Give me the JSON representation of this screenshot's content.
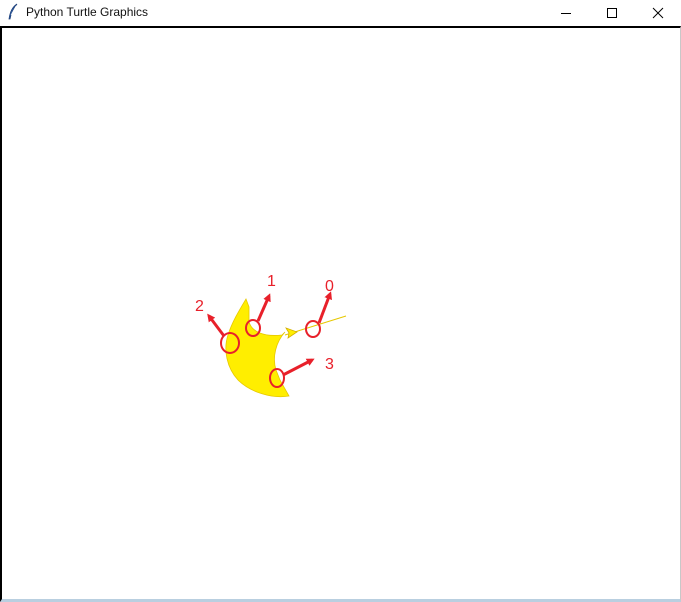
{
  "window": {
    "title": "Python Turtle Graphics",
    "icon": "feather-icon",
    "controls": [
      "minimize-icon",
      "maximize-icon",
      "close-icon"
    ]
  },
  "canvas": {
    "background": "#ffffff",
    "shape_fill": "#ffee00",
    "shape_stroke": "#e6c800",
    "annotation_color": "#e8202a",
    "annotations": [
      {
        "label": "0"
      },
      {
        "label": "1"
      },
      {
        "label": "2"
      },
      {
        "label": "3"
      }
    ]
  }
}
